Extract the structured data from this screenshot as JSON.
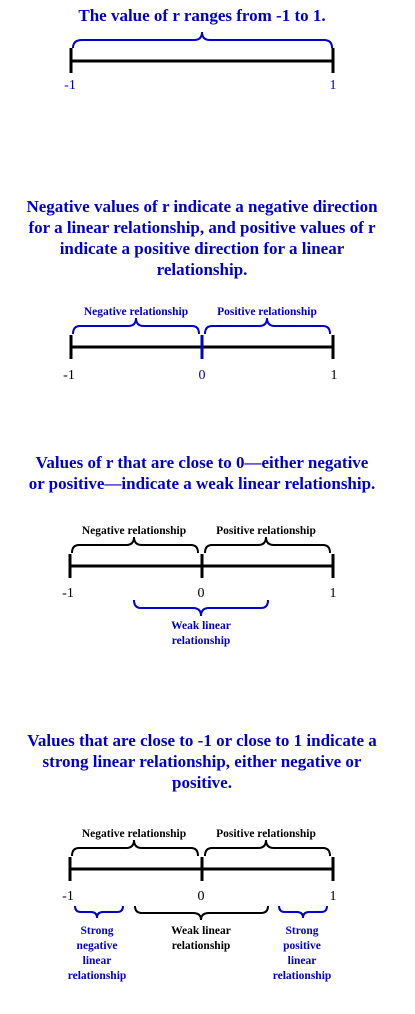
{
  "section1": {
    "heading": "The value of r ranges from -1 to 1.",
    "tick_min": "-1",
    "tick_max": "1"
  },
  "section2": {
    "heading": [
      "Negative values of r indicate a negative direction",
      "for a linear relationship, and positive values of r",
      "indicate a positive direction for a linear",
      "relationship."
    ],
    "negative_label": "Negative relationship",
    "positive_label": "Positive relationship",
    "tick_min": "-1",
    "tick_mid": "0",
    "tick_max": "1"
  },
  "section3": {
    "heading": [
      "Values of r that are close to 0—either negative",
      "or positive—indicate a weak linear relationship."
    ],
    "negative_label": "Negative relationship",
    "positive_label": "Positive relationship",
    "tick_min": "-1",
    "tick_mid": "0",
    "tick_max": "1",
    "weak_label": [
      "Weak linear",
      "relationship"
    ]
  },
  "section4": {
    "heading": [
      "Values that are close to -1 or close to 1 indicate a",
      "strong linear relationship, either negative or",
      "positive."
    ],
    "negative_label": "Negative relationship",
    "positive_label": "Positive relationship",
    "tick_min": "-1",
    "tick_mid": "0",
    "tick_max": "1",
    "strong_negative_label": [
      "Strong",
      "negative",
      "linear",
      "relationship"
    ],
    "weak_label": [
      "Weak linear",
      "relationship"
    ],
    "strong_positive_label": [
      "Strong",
      "positive",
      "linear",
      "relationship"
    ]
  },
  "colors": {
    "blue": "#0000cc",
    "black": "#000000"
  }
}
